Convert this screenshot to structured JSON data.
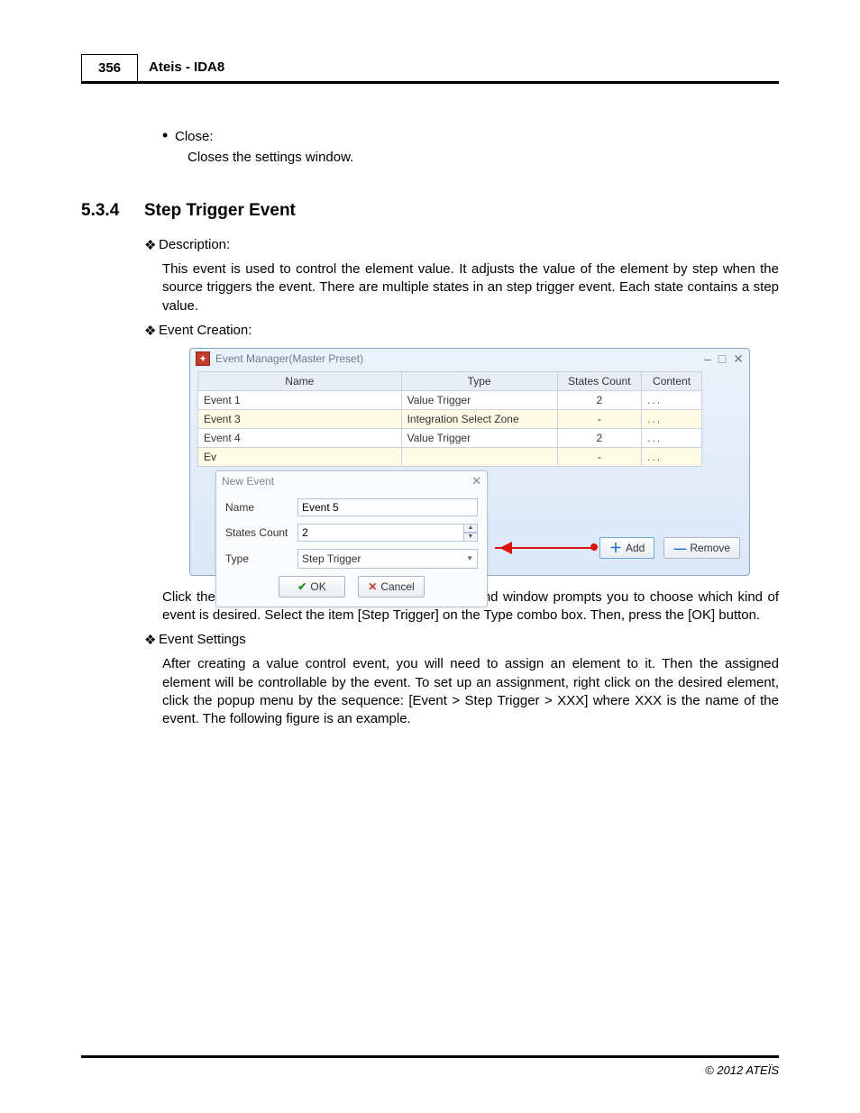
{
  "header": {
    "page_number": "356",
    "title": "Ateis - IDA8"
  },
  "top_item": {
    "label": "Close:",
    "desc": "Closes the settings window."
  },
  "section": {
    "number": "5.3.4",
    "title": "Step Trigger Event"
  },
  "desc_label": "Description:",
  "desc_text": "This event is used to control the element value. It adjusts the value of the element by step when the source triggers the event. There are multiple states in an step trigger event. Each state contains a step value.",
  "creation_label": "Event Creation:",
  "window": {
    "title": "Event Manager(Master Preset)",
    "headers": {
      "name": "Name",
      "type": "Type",
      "states": "States Count",
      "content": "Content"
    },
    "rows": [
      {
        "name": "Event 1",
        "type": "Value Trigger",
        "states": "2",
        "content": "..."
      },
      {
        "name": "Event 3",
        "type": "Integration Select Zone",
        "states": "-",
        "content": "..."
      },
      {
        "name": "Event 4",
        "type": "Value Trigger",
        "states": "2",
        "content": "..."
      },
      {
        "name": "Ev",
        "type": "",
        "states": "-",
        "content": "..."
      }
    ],
    "add_label": "Add",
    "remove_label": "Remove"
  },
  "popup": {
    "title": "New Event",
    "name_label": "Name",
    "name_value": "Event 5",
    "states_label": "States Count",
    "states_value": "2",
    "type_label": "Type",
    "type_value": "Step Trigger",
    "ok": "OK",
    "cancel": "Cancel"
  },
  "creation_text": "Click the [Add] button to create a new event, a second window prompts you to choose which kind of event is desired. Select the item [Step Trigger] on the Type combo box. Then, press the [OK] button.",
  "settings_label": "Event Settings",
  "settings_text": "After creating a value control event, you will need to assign an element to it. Then the assigned element will be controllable by the event. To set up an assignment, right click on the desired element, click the popup menu by the sequence: [Event > Step Trigger > XXX] where XXX is the name of the event. The following figure is an example.",
  "footer": "© 2012 ATEÏS"
}
